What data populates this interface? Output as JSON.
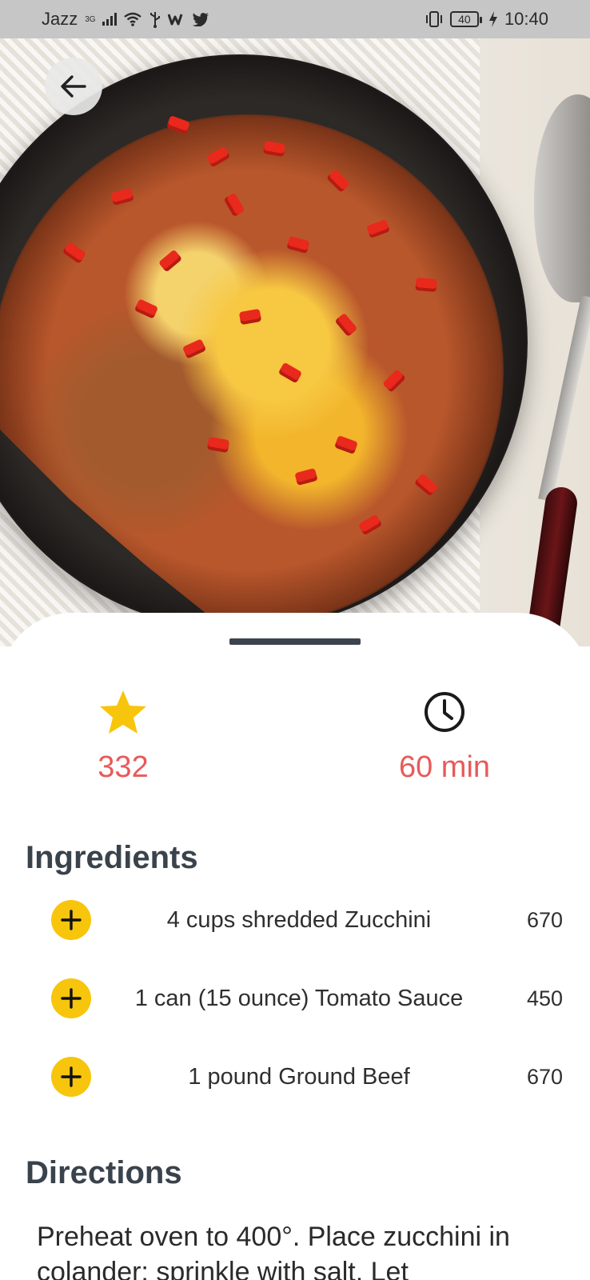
{
  "status_bar": {
    "carrier": "Jazz",
    "network_type": "3G",
    "battery_level": "40",
    "time": "10:40",
    "icons": [
      "signal-icon",
      "wifi-icon",
      "usb-icon",
      "w-app-icon",
      "twitter-icon",
      "vibrate-icon",
      "battery-icon",
      "charging-icon"
    ]
  },
  "hero": {
    "image_description_icon": "recipe-photo"
  },
  "stats": {
    "rating_value": "332",
    "time_value": "60 min",
    "rating_icon": "star-icon",
    "time_icon": "clock-icon"
  },
  "ingredients": {
    "title": "Ingredients",
    "items": [
      {
        "name": "4 cups shredded Zucchini",
        "amount": "670"
      },
      {
        "name": "1 can (15 ounce) Tomato Sauce",
        "amount": "450"
      },
      {
        "name": "1 pound Ground Beef",
        "amount": "670"
      }
    ]
  },
  "directions": {
    "title": "Directions",
    "text": "Preheat oven to 400°. Place zucchini in colander; sprinkle with salt. Let"
  },
  "colors": {
    "accent_yellow": "#f7c50c",
    "value_red": "#e85a5a",
    "heading": "#3a434c",
    "status_bar_bg": "#c6c6c6"
  }
}
